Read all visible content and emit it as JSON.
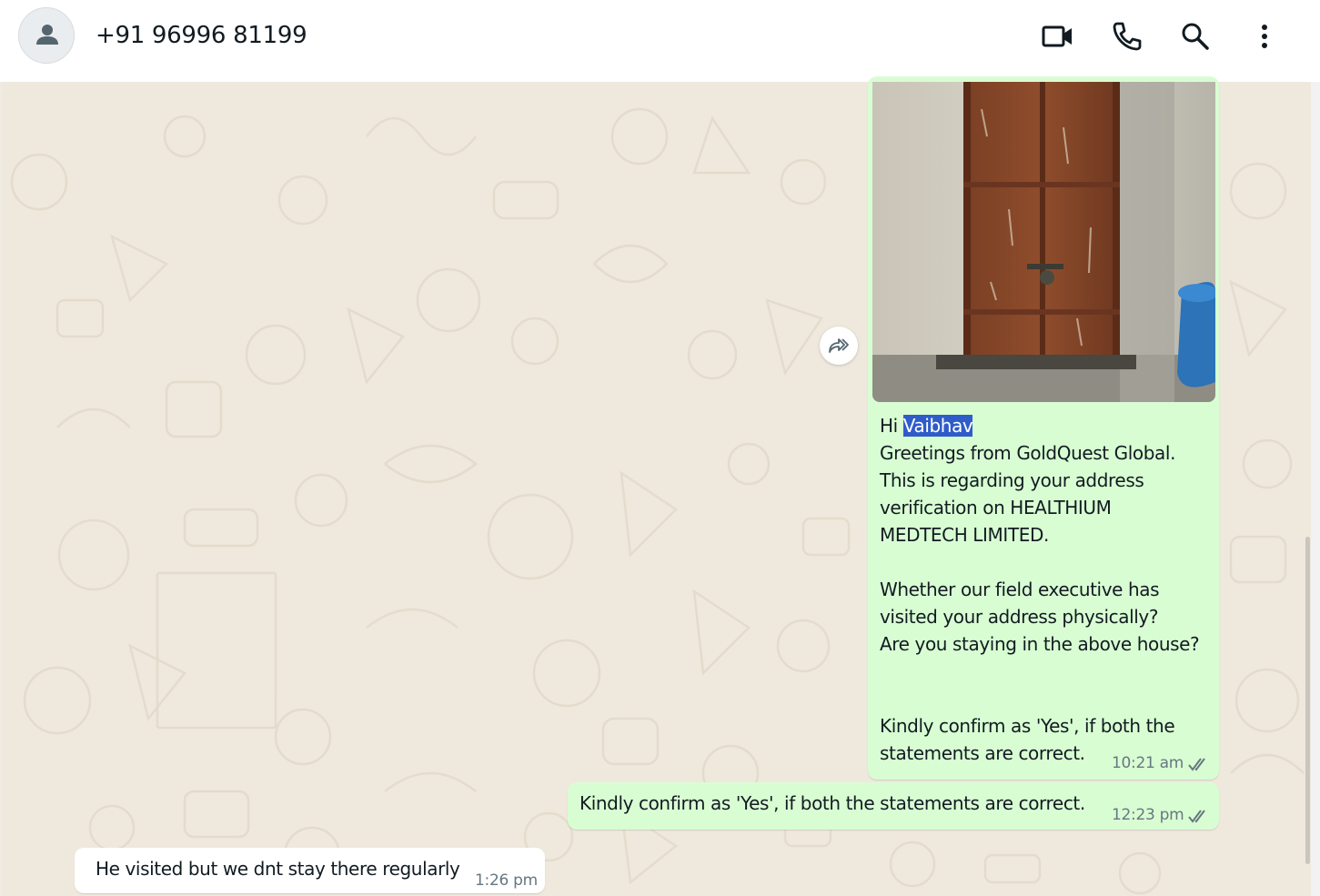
{
  "header": {
    "contact_name": "+91 96996 81199",
    "icons": [
      "person-icon",
      "video-call-icon",
      "voice-call-icon",
      "search-icon",
      "menu-icon"
    ]
  },
  "messages": [
    {
      "direction": "outgoing",
      "has_image": true,
      "greeting": "Hi ",
      "highlighted_name": "Vaibhav",
      "lines": [
        "Greetings from GoldQuest Global.",
        "This is regarding your address",
        "verification on HEALTHIUM",
        "MEDTECH LIMITED.",
        "",
        "Whether our field executive has",
        "visited your address physically?",
        "Are you staying in the above house?",
        "",
        "",
        "Kindly confirm as 'Yes', if both the",
        "statements are correct."
      ],
      "time": "10:21 am",
      "status": "read"
    },
    {
      "direction": "outgoing",
      "text": "Kindly confirm as 'Yes', if both the statements are correct.",
      "time": "12:23 pm",
      "status": "read"
    },
    {
      "direction": "incoming",
      "text": "He visited but we dnt stay there regularly",
      "time": "1:26 pm"
    }
  ],
  "colors": {
    "outgoing_bubble": "#d9fdd3",
    "incoming_bubble": "#ffffff",
    "chat_background": "#efe8dc",
    "read_ticks": "#667781",
    "highlight": "#2f5cc9"
  }
}
